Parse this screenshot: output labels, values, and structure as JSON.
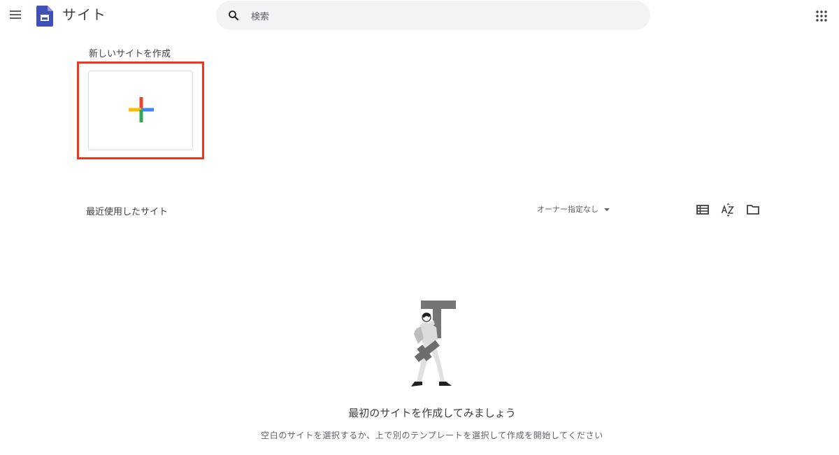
{
  "header": {
    "app_title": "サイト",
    "search": {
      "placeholder": "検索",
      "value": ""
    }
  },
  "new_site": {
    "label": "新しいサイトを作成",
    "highlight_color": "#f0361d"
  },
  "recent": {
    "label": "最近使用したサイト",
    "owner_filter": "オーナー指定なし"
  },
  "empty_state": {
    "title": "最初のサイトを作成してみましょう",
    "subtitle": "空白のサイトを選択するか、上で別のテンプレートを選択して作成を開始してください"
  },
  "icons": {
    "menu": "hamburger-menu-icon",
    "logo": "google-sites-logo",
    "search": "search-icon",
    "apps": "apps-grid-icon",
    "plus": "colored-plus-icon",
    "list_view": "list-view-icon",
    "sort": "sort-az-icon",
    "folder": "folder-icon"
  },
  "colors": {
    "sites_brand": "#4051b5",
    "plus_red": "#ea4335",
    "plus_blue": "#4285f4",
    "plus_yellow": "#fbbc04",
    "plus_green": "#34a853"
  }
}
